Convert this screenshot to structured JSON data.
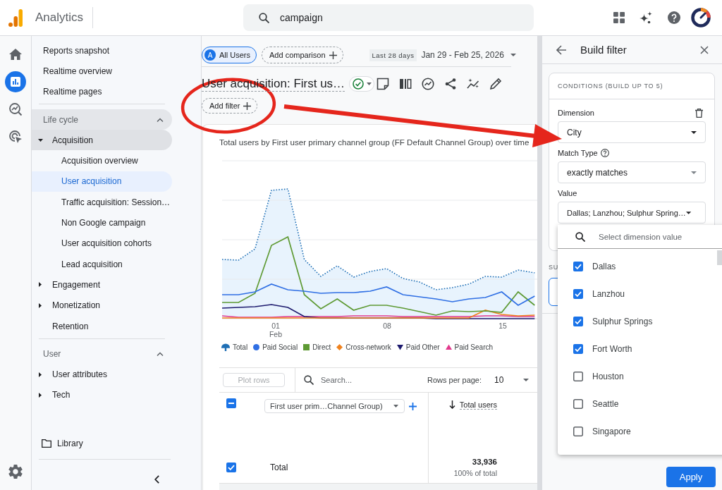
{
  "top_bar": {
    "app_name": "Analytics",
    "search": {
      "value": "campaign"
    }
  },
  "rail": {
    "items": [
      {
        "selected": false
      },
      {
        "selected": true
      },
      {
        "selected": false
      },
      {
        "selected": false
      }
    ]
  },
  "nav": {
    "top_items": [
      {
        "label": "Reports snapshot",
        "selected": false
      },
      {
        "label": "Realtime overview",
        "selected": false
      },
      {
        "label": "Realtime pages",
        "selected": false
      }
    ],
    "sections": [
      {
        "title": "Life cycle",
        "expanded": true,
        "hovered": true,
        "items": [
          {
            "label": "Acquisition",
            "kind": "group",
            "expanded": true,
            "selected": false,
            "children": [
              {
                "label": "Acquisition overview",
                "selected": false
              },
              {
                "label": "User acquisition",
                "selected": true
              },
              {
                "label": "Traffic acquisition: Session…",
                "selected": false
              },
              {
                "label": "Non Google campaign",
                "selected": false
              },
              {
                "label": "User acquisition cohorts",
                "selected": false
              },
              {
                "label": "Lead acquisition",
                "selected": false
              }
            ]
          },
          {
            "label": "Engagement",
            "kind": "group",
            "expanded": false,
            "selected": false
          },
          {
            "label": "Monetization",
            "kind": "group",
            "expanded": false,
            "selected": false
          },
          {
            "label": "Retention",
            "kind": "page",
            "selected": false
          }
        ]
      },
      {
        "title": "User",
        "expanded": true,
        "hovered": false,
        "items": [
          {
            "label": "User attributes",
            "kind": "group",
            "expanded": false,
            "selected": false
          },
          {
            "label": "Tech",
            "kind": "group",
            "expanded": false,
            "selected": false
          }
        ]
      }
    ],
    "library": {
      "label": "Library",
      "selected": false
    }
  },
  "comparison_bar": {
    "segments": [
      {
        "avatar": "A",
        "label": "All Users"
      }
    ],
    "add_comparison": "Add comparison",
    "date_preset": "Last 28 days",
    "date_range": "Jan 29 - Feb 25, 2026"
  },
  "report": {
    "title": "User acquisition: First us…",
    "add_filter": "Add filter"
  },
  "chart": {
    "title": "Total users by First user primary channel group (FF Default Channel Group) over time",
    "x_labels": [
      {
        "day": "01",
        "month": "Feb"
      },
      {
        "day": "08"
      },
      {
        "day": "15"
      }
    ],
    "legend": [
      {
        "label": "Total",
        "kind": "area",
        "color": "#1f6fb5"
      },
      {
        "label": "Paid Social",
        "kind": "dot",
        "color": "#2f6fe4"
      },
      {
        "label": "Direct",
        "kind": "square",
        "color": "#5e9a34"
      },
      {
        "label": "Cross-network",
        "kind": "diamond",
        "color": "#f0821e"
      },
      {
        "label": "Paid Other",
        "kind": "down",
        "color": "#1d1a6e"
      },
      {
        "label": "Paid Search",
        "kind": "up",
        "color": "#e2398c"
      }
    ]
  },
  "table": {
    "plot_rows": {
      "label": "Plot rows",
      "disabled": true
    },
    "search": {
      "placeholder": "Search..."
    },
    "rows_per_page_label": "Rows per page:",
    "rows_per_page": "10",
    "header_checkbox": {
      "indeterminate": true
    },
    "dimension": "First user prim…Channel Group)",
    "metric": "Total users",
    "rows": [
      {
        "label": "Total",
        "value": "33,936",
        "share": "100% of total",
        "checked": true
      }
    ]
  },
  "filter_panel": {
    "title": "Build filter",
    "conditions_heading": "CONDITIONS (BUILD UP TO 5)",
    "fields": [
      {
        "kind": "dimension",
        "label": "Dimension",
        "value": "City"
      },
      {
        "kind": "match",
        "label": "Match Type",
        "value": "exactly matches"
      },
      {
        "kind": "value",
        "label": "Value",
        "value": "Dallas; Lanzhou; Sulphur Spring…"
      }
    ],
    "next_section": "SU",
    "value_picker": {
      "placeholder": "Select dimension value",
      "options": [
        {
          "label": "Dallas",
          "checked": true
        },
        {
          "label": "Lanzhou",
          "checked": true
        },
        {
          "label": "Sulphur Springs",
          "checked": true
        },
        {
          "label": "Fort Worth",
          "checked": true
        },
        {
          "label": "Houston",
          "checked": false
        },
        {
          "label": "Seattle",
          "checked": false
        },
        {
          "label": "Singapore",
          "checked": false
        }
      ]
    },
    "apply": "Apply"
  }
}
